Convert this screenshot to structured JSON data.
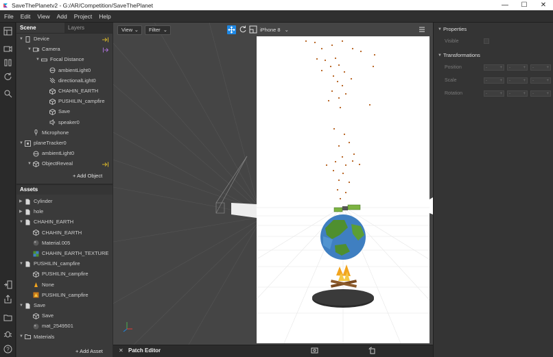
{
  "window": {
    "title": "SaveThePlanetv2 - G:/AR/Competition/SaveThePlanet",
    "minimize": "—",
    "maximize": "☐",
    "close": "✕"
  },
  "menu": [
    "File",
    "Edit",
    "View",
    "Add",
    "Project",
    "Help"
  ],
  "scene_panel": {
    "tabs": [
      "Scene",
      "Layers"
    ],
    "tree": [
      {
        "label": "Device",
        "icon": "device-icon",
        "indent": 0,
        "caret": true
      },
      {
        "label": "Camera",
        "icon": "camera-icon",
        "indent": 1,
        "caret": true
      },
      {
        "label": "Focal Distance",
        "icon": "focal-icon",
        "indent": 2,
        "caret": true
      },
      {
        "label": "ambientLight0",
        "icon": "ambient-light-icon",
        "indent": 3
      },
      {
        "label": "directionalLight0",
        "icon": "directional-light-icon",
        "indent": 3
      },
      {
        "label": "CHAHIN_EARTH",
        "icon": "object-icon",
        "indent": 3
      },
      {
        "label": "PUSHILIN_campfire",
        "icon": "object-icon",
        "indent": 3
      },
      {
        "label": "Save",
        "icon": "object-icon",
        "indent": 3
      },
      {
        "label": "speaker0",
        "icon": "speaker-icon",
        "indent": 3
      },
      {
        "label": "Microphone",
        "icon": "microphone-icon",
        "indent": 1
      },
      {
        "label": "planeTracker0",
        "icon": "plane-tracker-icon",
        "indent": 0,
        "caret": true
      },
      {
        "label": "ambientLight0",
        "icon": "ambient-light-icon",
        "indent": 1
      },
      {
        "label": "ObjectReveal",
        "icon": "object-icon",
        "indent": 1,
        "caret": true
      }
    ],
    "add_object": "Add Object"
  },
  "assets_panel": {
    "header": "Assets",
    "items": [
      {
        "label": "Cylinder",
        "icon": "file-icon",
        "indent": 0,
        "caret": "right"
      },
      {
        "label": "hole",
        "icon": "file-icon",
        "indent": 0,
        "caret": "right"
      },
      {
        "label": "CHAHIN_EARTH",
        "icon": "file-icon",
        "indent": 0,
        "caret": "down"
      },
      {
        "label": "CHAHIN_EARTH",
        "icon": "object-icon",
        "indent": 1
      },
      {
        "label": "Material.005",
        "icon": "material-icon",
        "indent": 1
      },
      {
        "label": "CHAHIN_EARTH_TEXTURE",
        "icon": "texture-icon",
        "indent": 1
      },
      {
        "label": "PUSHILIN_campfire",
        "icon": "file-icon",
        "indent": 0,
        "caret": "down"
      },
      {
        "label": "PUSHILIN_campfire",
        "icon": "object-icon",
        "indent": 1
      },
      {
        "label": "None",
        "icon": "campfire-material-icon",
        "indent": 1
      },
      {
        "label": "PUSHILIN_campfire",
        "icon": "campfire-texture-icon",
        "indent": 1
      },
      {
        "label": "Save",
        "icon": "file-icon",
        "indent": 0,
        "caret": "down"
      },
      {
        "label": "Save",
        "icon": "object-icon",
        "indent": 1
      },
      {
        "label": "mat_2549501",
        "icon": "material-icon",
        "indent": 1
      },
      {
        "label": "Materials",
        "icon": "folder-icon",
        "indent": 0,
        "caret": "down"
      }
    ],
    "add_asset": "Add Asset"
  },
  "viewport": {
    "view_dropdown": "View",
    "filter_dropdown": "Filter",
    "device_dropdown": "iPhone 8"
  },
  "bottom": {
    "close": "✕",
    "patch_editor": "Patch Editor"
  },
  "properties": {
    "section_properties": "Properties",
    "visible_label": "Visible",
    "section_transformations": "Transformations",
    "position_label": "Position",
    "scale_label": "Scale",
    "rotation_label": "Rotation"
  },
  "colors": {
    "accent_blue": "#1e88e5",
    "add_icon_yellow": "#d4b32a",
    "add_icon_purple": "#a86fd4"
  }
}
